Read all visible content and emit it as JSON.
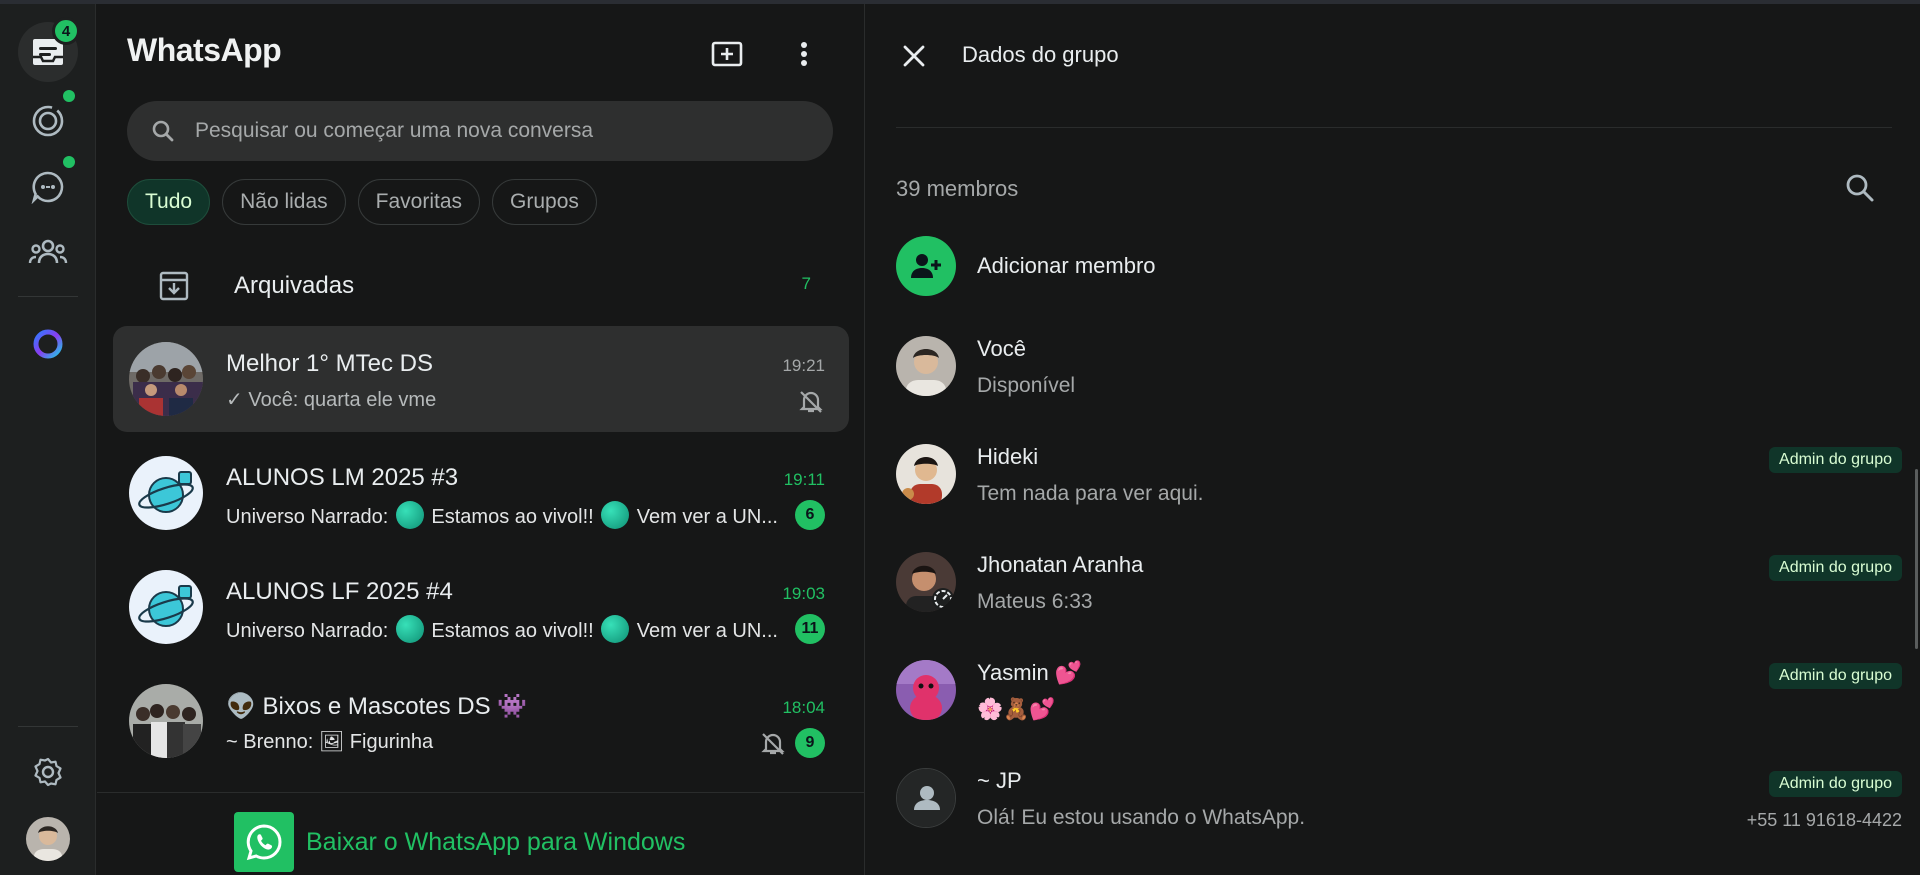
{
  "rail": {
    "chats_badge": "4",
    "icons": [
      "chats-icon",
      "status-icon",
      "channels-icon",
      "communities-icon",
      "meta-ai-icon",
      "settings-icon",
      "profile-avatar"
    ]
  },
  "list": {
    "app_title": "WhatsApp",
    "search_placeholder": "Pesquisar ou começar uma nova conversa",
    "filters": [
      "Tudo",
      "Não lidas",
      "Favoritas",
      "Grupos"
    ],
    "active_filter": "Tudo",
    "archived": {
      "label": "Arquivadas",
      "count": "7"
    },
    "chats": [
      {
        "name": "Melhor 1° MTec DS",
        "time": "19:21",
        "preview_prefix": "✓ ",
        "preview": "Você: quarta ele vme",
        "muted": true,
        "selected": true
      },
      {
        "name": "ALUNOS LM 2025 #3",
        "time": "19:11",
        "preview_a": "Universo Narrado: ",
        "preview_b": " Estamos ao vivol!! ",
        "preview_c": " Vem ver a UN...",
        "unread": "6"
      },
      {
        "name": "ALUNOS LF 2025 #4",
        "time": "19:03",
        "preview_a": "Universo Narrado: ",
        "preview_b": " Estamos ao vivol!! ",
        "preview_c": " Vem ver a UN...",
        "unread": "11"
      },
      {
        "name": "👽 Bixos e Mascotes DS 👾",
        "time": "18:04",
        "preview": "~ Brenno: 🖼 Figurinha",
        "muted": true,
        "unread": "9"
      }
    ],
    "download_label": "Baixar o WhatsApp para Windows"
  },
  "group_info": {
    "title": "Dados do grupo",
    "members_count": "39 membros",
    "add_member_label": "Adicionar membro",
    "admin_label": "Admin do grupo",
    "members": [
      {
        "name": "Você",
        "status": "Disponível",
        "admin": false
      },
      {
        "name": "Hideki",
        "status": "Tem nada para ver aqui.",
        "admin": true
      },
      {
        "name": "Jhonatan Aranha",
        "status": "Mateus 6:33",
        "admin": true
      },
      {
        "name": "Yasmin 💕",
        "status": "🌸🧸💕",
        "admin": true
      },
      {
        "name": "~ JP",
        "status": "Olá! Eu estou usando o WhatsApp.",
        "admin": true,
        "phone": "+55 11 91618-4422"
      }
    ]
  },
  "colors": {
    "accent": "#21c063",
    "background": "#161717",
    "panel": "#1d1f1f",
    "selected": "#2e2f2f",
    "badge_bg": "#103529"
  }
}
